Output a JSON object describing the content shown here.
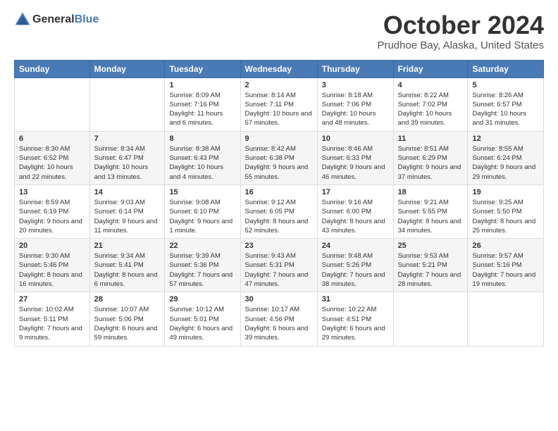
{
  "header": {
    "logo_general": "General",
    "logo_blue": "Blue",
    "month_title": "October 2024",
    "location": "Prudhoe Bay, Alaska, United States"
  },
  "weekdays": [
    "Sunday",
    "Monday",
    "Tuesday",
    "Wednesday",
    "Thursday",
    "Friday",
    "Saturday"
  ],
  "weeks": [
    [
      {
        "day": "",
        "sunrise": "",
        "sunset": "",
        "daylight": ""
      },
      {
        "day": "",
        "sunrise": "",
        "sunset": "",
        "daylight": ""
      },
      {
        "day": "1",
        "sunrise": "Sunrise: 8:09 AM",
        "sunset": "Sunset: 7:16 PM",
        "daylight": "Daylight: 11 hours and 6 minutes."
      },
      {
        "day": "2",
        "sunrise": "Sunrise: 8:14 AM",
        "sunset": "Sunset: 7:11 PM",
        "daylight": "Daylight: 10 hours and 57 minutes."
      },
      {
        "day": "3",
        "sunrise": "Sunrise: 8:18 AM",
        "sunset": "Sunset: 7:06 PM",
        "daylight": "Daylight: 10 hours and 48 minutes."
      },
      {
        "day": "4",
        "sunrise": "Sunrise: 8:22 AM",
        "sunset": "Sunset: 7:02 PM",
        "daylight": "Daylight: 10 hours and 39 minutes."
      },
      {
        "day": "5",
        "sunrise": "Sunrise: 8:26 AM",
        "sunset": "Sunset: 6:57 PM",
        "daylight": "Daylight: 10 hours and 31 minutes."
      }
    ],
    [
      {
        "day": "6",
        "sunrise": "Sunrise: 8:30 AM",
        "sunset": "Sunset: 6:52 PM",
        "daylight": "Daylight: 10 hours and 22 minutes."
      },
      {
        "day": "7",
        "sunrise": "Sunrise: 8:34 AM",
        "sunset": "Sunset: 6:47 PM",
        "daylight": "Daylight: 10 hours and 13 minutes."
      },
      {
        "day": "8",
        "sunrise": "Sunrise: 8:38 AM",
        "sunset": "Sunset: 6:43 PM",
        "daylight": "Daylight: 10 hours and 4 minutes."
      },
      {
        "day": "9",
        "sunrise": "Sunrise: 8:42 AM",
        "sunset": "Sunset: 6:38 PM",
        "daylight": "Daylight: 9 hours and 55 minutes."
      },
      {
        "day": "10",
        "sunrise": "Sunrise: 8:46 AM",
        "sunset": "Sunset: 6:33 PM",
        "daylight": "Daylight: 9 hours and 46 minutes."
      },
      {
        "day": "11",
        "sunrise": "Sunrise: 8:51 AM",
        "sunset": "Sunset: 6:29 PM",
        "daylight": "Daylight: 9 hours and 37 minutes."
      },
      {
        "day": "12",
        "sunrise": "Sunrise: 8:55 AM",
        "sunset": "Sunset: 6:24 PM",
        "daylight": "Daylight: 9 hours and 29 minutes."
      }
    ],
    [
      {
        "day": "13",
        "sunrise": "Sunrise: 8:59 AM",
        "sunset": "Sunset: 6:19 PM",
        "daylight": "Daylight: 9 hours and 20 minutes."
      },
      {
        "day": "14",
        "sunrise": "Sunrise: 9:03 AM",
        "sunset": "Sunset: 6:14 PM",
        "daylight": "Daylight: 9 hours and 11 minutes."
      },
      {
        "day": "15",
        "sunrise": "Sunrise: 9:08 AM",
        "sunset": "Sunset: 6:10 PM",
        "daylight": "Daylight: 9 hours and 1 minute."
      },
      {
        "day": "16",
        "sunrise": "Sunrise: 9:12 AM",
        "sunset": "Sunset: 6:05 PM",
        "daylight": "Daylight: 8 hours and 52 minutes."
      },
      {
        "day": "17",
        "sunrise": "Sunrise: 9:16 AM",
        "sunset": "Sunset: 6:00 PM",
        "daylight": "Daylight: 8 hours and 43 minutes."
      },
      {
        "day": "18",
        "sunrise": "Sunrise: 9:21 AM",
        "sunset": "Sunset: 5:55 PM",
        "daylight": "Daylight: 8 hours and 34 minutes."
      },
      {
        "day": "19",
        "sunrise": "Sunrise: 9:25 AM",
        "sunset": "Sunset: 5:50 PM",
        "daylight": "Daylight: 8 hours and 25 minutes."
      }
    ],
    [
      {
        "day": "20",
        "sunrise": "Sunrise: 9:30 AM",
        "sunset": "Sunset: 5:46 PM",
        "daylight": "Daylight: 8 hours and 16 minutes."
      },
      {
        "day": "21",
        "sunrise": "Sunrise: 9:34 AM",
        "sunset": "Sunset: 5:41 PM",
        "daylight": "Daylight: 8 hours and 6 minutes."
      },
      {
        "day": "22",
        "sunrise": "Sunrise: 9:39 AM",
        "sunset": "Sunset: 5:36 PM",
        "daylight": "Daylight: 7 hours and 57 minutes."
      },
      {
        "day": "23",
        "sunrise": "Sunrise: 9:43 AM",
        "sunset": "Sunset: 5:31 PM",
        "daylight": "Daylight: 7 hours and 47 minutes."
      },
      {
        "day": "24",
        "sunrise": "Sunrise: 9:48 AM",
        "sunset": "Sunset: 5:26 PM",
        "daylight": "Daylight: 7 hours and 38 minutes."
      },
      {
        "day": "25",
        "sunrise": "Sunrise: 9:53 AM",
        "sunset": "Sunset: 5:21 PM",
        "daylight": "Daylight: 7 hours and 28 minutes."
      },
      {
        "day": "26",
        "sunrise": "Sunrise: 9:57 AM",
        "sunset": "Sunset: 5:16 PM",
        "daylight": "Daylight: 7 hours and 19 minutes."
      }
    ],
    [
      {
        "day": "27",
        "sunrise": "Sunrise: 10:02 AM",
        "sunset": "Sunset: 5:11 PM",
        "daylight": "Daylight: 7 hours and 9 minutes."
      },
      {
        "day": "28",
        "sunrise": "Sunrise: 10:07 AM",
        "sunset": "Sunset: 5:06 PM",
        "daylight": "Daylight: 6 hours and 59 minutes."
      },
      {
        "day": "29",
        "sunrise": "Sunrise: 10:12 AM",
        "sunset": "Sunset: 5:01 PM",
        "daylight": "Daylight: 6 hours and 49 minutes."
      },
      {
        "day": "30",
        "sunrise": "Sunrise: 10:17 AM",
        "sunset": "Sunset: 4:56 PM",
        "daylight": "Daylight: 6 hours and 39 minutes."
      },
      {
        "day": "31",
        "sunrise": "Sunrise: 10:22 AM",
        "sunset": "Sunset: 4:51 PM",
        "daylight": "Daylight: 6 hours and 29 minutes."
      },
      {
        "day": "",
        "sunrise": "",
        "sunset": "",
        "daylight": ""
      },
      {
        "day": "",
        "sunrise": "",
        "sunset": "",
        "daylight": ""
      }
    ]
  ]
}
